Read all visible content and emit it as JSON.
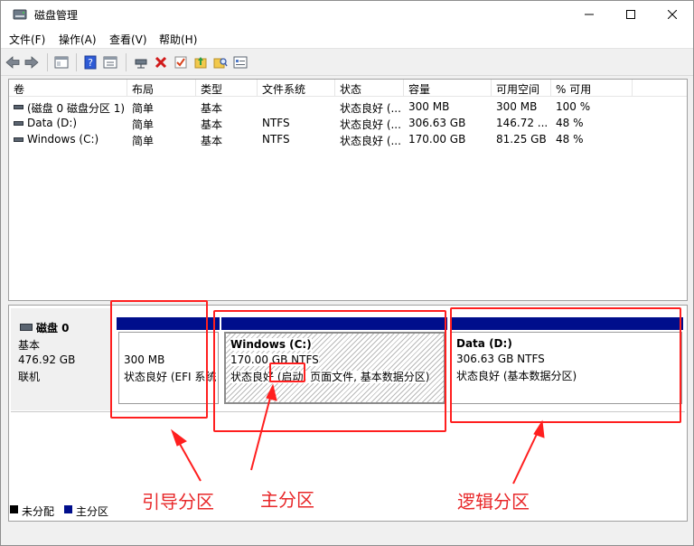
{
  "window": {
    "title": "磁盘管理",
    "icon": "disk-management-icon"
  },
  "menu": [
    "文件(F)",
    "操作(A)",
    "查看(V)",
    "帮助(H)"
  ],
  "volume_table": {
    "columns": [
      "卷",
      "布局",
      "类型",
      "文件系统",
      "状态",
      "容量",
      "可用空间",
      "% 可用"
    ],
    "rows": [
      [
        "(磁盘 0 磁盘分区 1)",
        "简单",
        "基本",
        "",
        "状态良好 (...",
        "300 MB",
        "300 MB",
        "100 %"
      ],
      [
        "Data (D:)",
        "简单",
        "基本",
        "NTFS",
        "状态良好 (...",
        "306.63 GB",
        "146.72 ...",
        "48 %"
      ],
      [
        "Windows (C:)",
        "简单",
        "基本",
        "NTFS",
        "状态良好 (...",
        "170.00 GB",
        "81.25 GB",
        "48 %"
      ]
    ]
  },
  "disk0": {
    "name": "磁盘 0",
    "type": "基本",
    "size": "476.92 GB",
    "status": "联机"
  },
  "partitions": {
    "efi": {
      "size": "300 MB",
      "status": "状态良好 (EFI 系统"
    },
    "c": {
      "title": "Windows (C:)",
      "size": "170.00 GB NTFS",
      "status": "状态良好 (启动, 页面文件, 基本数据分区)"
    },
    "d": {
      "title": "Data (D:)",
      "size": "306.63 GB NTFS",
      "status": "状态良好 (基本数据分区)"
    }
  },
  "legend": {
    "unallocated": "未分配",
    "primary": "主分区"
  },
  "annotations": {
    "boot": "引导分区",
    "primary": "主分区",
    "logical": "逻辑分区"
  },
  "colors": {
    "partition_bar": "#000e8c",
    "annotation": "#ff1f1f"
  }
}
